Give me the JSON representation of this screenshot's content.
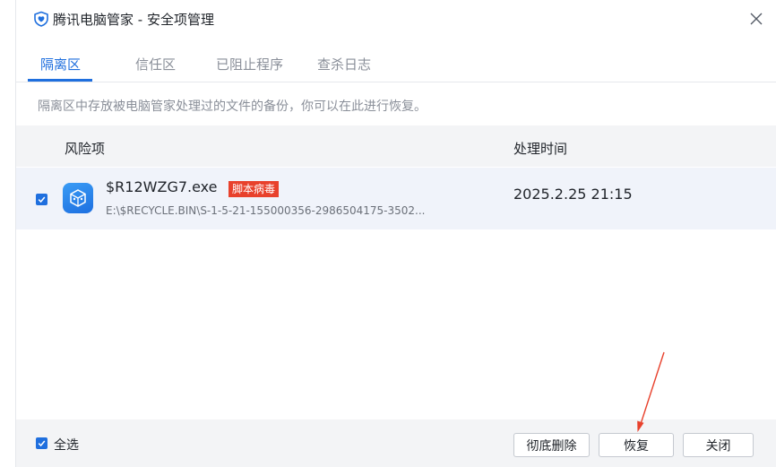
{
  "window": {
    "title": "腾讯电脑管家 - 安全项管理"
  },
  "tabs": [
    {
      "label": "隔离区",
      "active": true
    },
    {
      "label": "信任区",
      "active": false
    },
    {
      "label": "已阻止程序",
      "active": false
    },
    {
      "label": "查杀日志",
      "active": false
    }
  ],
  "description": "隔离区中存放被电脑管家处理过的文件的备份，你可以在此进行恢复。",
  "table": {
    "columns": [
      "风险项",
      "处理时间"
    ],
    "rows": [
      {
        "checked": true,
        "name": "$R12WZG7.exe",
        "badge": "脚本病毒",
        "path": "E:\\$RECYCLE.BIN\\S-1-5-21-155000356-2986504175-3502...",
        "time": "2025.2.25 21:15"
      }
    ]
  },
  "footer": {
    "select_all": {
      "label": "全选",
      "checked": true
    },
    "buttons": {
      "delete": "彻底删除",
      "restore": "恢复",
      "close": "关闭"
    }
  },
  "colors": {
    "accent": "#1f6fde",
    "badge": "#e8412c",
    "annotation_arrow": "#e8412c"
  }
}
